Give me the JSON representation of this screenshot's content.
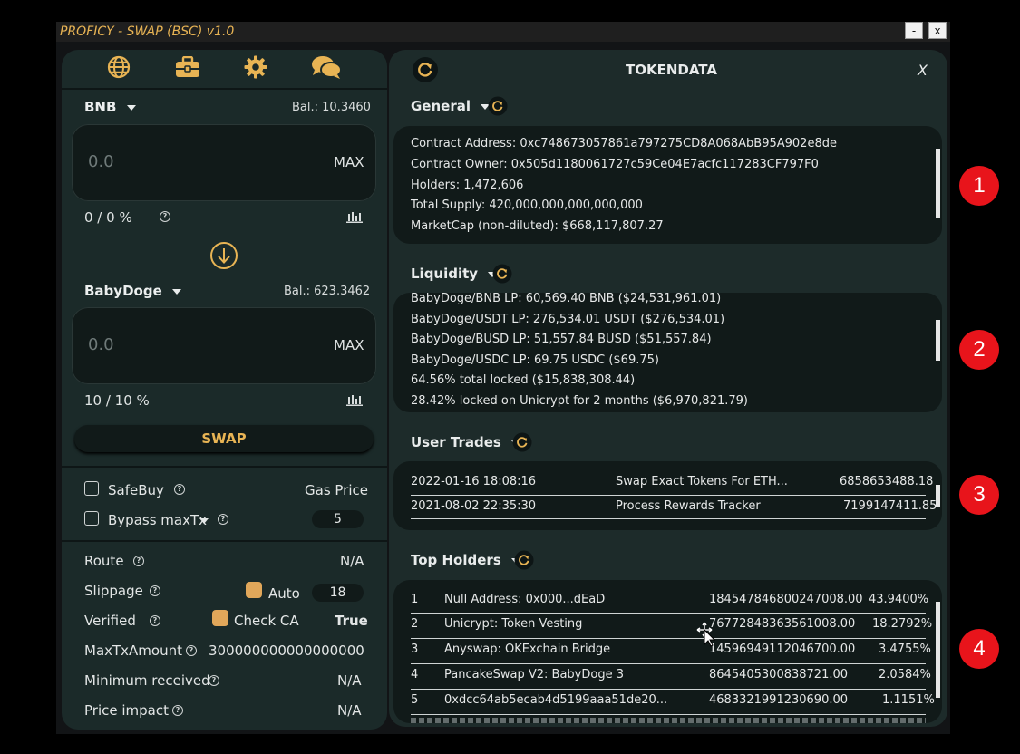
{
  "window": {
    "title": "PROFICY - SWAP (BSC) v1.0",
    "minimize": "-",
    "close": "x"
  },
  "nav_icons": [
    "globe-icon",
    "toolbox-icon",
    "gear-icon",
    "chat-icon"
  ],
  "from": {
    "token": "BNB",
    "balance": "Bal.: 10.3460",
    "placeholder": "0.0",
    "max": "MAX",
    "percent": "0 / 0 %"
  },
  "to": {
    "token": "BabyDoge",
    "balance": "Bal.: 623.3462",
    "placeholder": "0.0",
    "max": "MAX",
    "percent": "10 / 10 %"
  },
  "swap_label": "SWAP",
  "options": {
    "safebuy": "SafeBuy",
    "gas_price_label": "Gas Price",
    "bypass": "Bypass maxTx",
    "gas_value": "5"
  },
  "details": {
    "route_label": "Route",
    "route_value": "N/A",
    "slippage_label": "Slippage",
    "auto_label": "Auto",
    "slippage_value": "18",
    "verified_label": "Verified",
    "check_ca_label": "Check CA",
    "verified_value": "True",
    "maxtx_label": "MaxTxAmount",
    "maxtx_value": "300000000000000000",
    "minrec_label": "Minimum received",
    "minrec_value": "N/A",
    "impact_label": "Price impact",
    "impact_value": "N/A"
  },
  "tokendata": {
    "title": "TOKENDATA",
    "close": "X",
    "general": {
      "title": "General",
      "lines": [
        "Contract Address: 0xc748673057861a797275CD8A068AbB95A902e8de",
        "Contract Owner: 0x505d1180061727c59Ce04E7acfc117283CF797F0",
        "Holders: 1,472,606",
        "Total Supply: 420,000,000,000,000,000",
        "MarketCap (non-diluted): $668,117,807.27"
      ]
    },
    "liquidity": {
      "title": "Liquidity",
      "lines": [
        "BabyDoge/BNB LP: 60,569.40 BNB ($24,531,961.01)",
        "BabyDoge/USDT LP: 276,534.01 USDT ($276,534.01)",
        "BabyDoge/BUSD LP: 51,557.84 BUSD ($51,557.84)",
        "BabyDoge/USDC LP: 69.75 USDC ($69.75)",
        "64.56% total locked ($15,838,308.44)",
        "28.42% locked on Unicrypt for 2 months ($6,970,821.79)"
      ]
    },
    "user_trades": {
      "title": "User Trades",
      "rows": [
        {
          "date": "2022-01-16 18:08:16",
          "action": "Swap Exact Tokens For ETH...",
          "amount": "6858653488.18"
        },
        {
          "date": "2021-08-02 22:35:30",
          "action": "Process Rewards Tracker",
          "amount": "7199147411.85"
        }
      ]
    },
    "top_holders": {
      "title": "Top Holders",
      "rows": [
        {
          "rank": "1",
          "name": "Null Address: 0x000...dEaD",
          "amount": "184547846800247008.00",
          "pct": "43.9400%"
        },
        {
          "rank": "2",
          "name": "Unicrypt: Token Vesting",
          "amount": "76772848363561008.00",
          "pct": "18.2792%"
        },
        {
          "rank": "3",
          "name": "Anyswap: OKExchain Bridge",
          "amount": "14596949112046700.00",
          "pct": "3.4755%"
        },
        {
          "rank": "4",
          "name": "PancakeSwap V2: BabyDoge 3",
          "amount": "8645405300838721.00",
          "pct": "2.0584%"
        },
        {
          "rank": "5",
          "name": "0xdcc64ab5ecab4d5199aaa51de20...",
          "amount": "4683321991230690.00",
          "pct": "1.1151%"
        }
      ]
    }
  },
  "badges": [
    "1",
    "2",
    "3",
    "4"
  ],
  "colors": {
    "accent": "#e8b454",
    "badge": "#e8141b",
    "panel": "#1b2a29"
  }
}
